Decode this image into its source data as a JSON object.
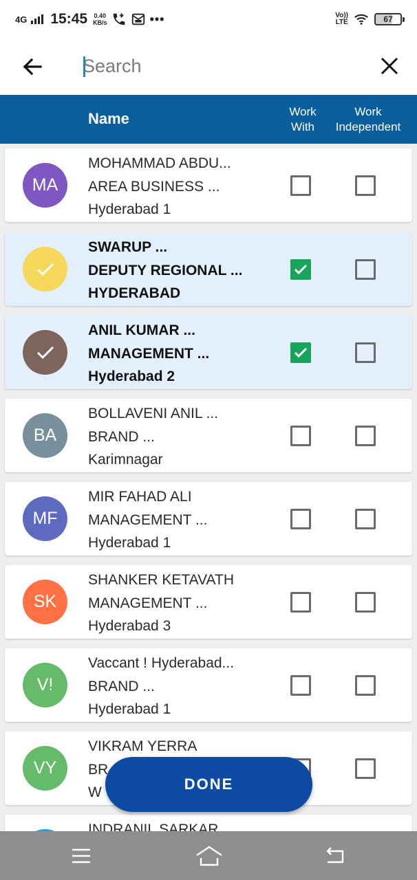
{
  "status_bar": {
    "network": "4G",
    "time": "15:45",
    "speed_value": "0.40",
    "speed_unit": "KB/s",
    "more": "•••",
    "volte_top": "Vo))",
    "volte_bottom": "LTE",
    "battery": "67",
    "icons": [
      "signal-icon",
      "phone-call-icon",
      "message-icon",
      "wifi-icon",
      "battery-icon"
    ]
  },
  "search": {
    "placeholder": "Search",
    "value": "",
    "icons": [
      "back-arrow-icon",
      "close-icon"
    ]
  },
  "table_header": {
    "name": "Name",
    "work_with_line1": "Work",
    "work_with_line2": "With",
    "work_independent_line1": "Work",
    "work_independent_line2": "Independent",
    "background": "#0b5e9c"
  },
  "rows": [
    {
      "initials": "MA",
      "avatar_color": "#7e57c2",
      "selected": false,
      "name": "MOHAMMAD ABDU...",
      "designation": "AREA BUSINESS ...",
      "location": "Hyderabad 1",
      "work_with": false,
      "work_independent": false
    },
    {
      "initials": "",
      "avatar_color": "#f5d85a",
      "selected": true,
      "name": "SWARUP ...",
      "designation": "DEPUTY REGIONAL ...",
      "location": "HYDERABAD",
      "work_with": true,
      "work_independent": false
    },
    {
      "initials": "",
      "avatar_color": "#7d645c",
      "selected": true,
      "name": "ANIL KUMAR ...",
      "designation": "MANAGEMENT ...",
      "location": "Hyderabad 2",
      "work_with": true,
      "work_independent": false
    },
    {
      "initials": "BA",
      "avatar_color": "#78909c",
      "selected": false,
      "name": "BOLLAVENI ANIL ...",
      "designation": "BRAND ...",
      "location": "Karimnagar",
      "work_with": false,
      "work_independent": false
    },
    {
      "initials": "MF",
      "avatar_color": "#5c6bc0",
      "selected": false,
      "name": "MIR FAHAD ALI",
      "designation": "MANAGEMENT ...",
      "location": "Hyderabad 1",
      "work_with": false,
      "work_independent": false
    },
    {
      "initials": "SK",
      "avatar_color": "#ff7043",
      "selected": false,
      "name": "SHANKER KETAVATH",
      "designation": "MANAGEMENT ...",
      "location": "Hyderabad 3",
      "work_with": false,
      "work_independent": false
    },
    {
      "initials": "V!",
      "avatar_color": "#66bb6a",
      "selected": false,
      "name": "Vaccant ! Hyderabad...",
      "designation": "BRAND ...",
      "location": "Hyderabad 1",
      "work_with": false,
      "work_independent": false
    },
    {
      "initials": "VY",
      "avatar_color": "#66bb6a",
      "selected": false,
      "name": "VIKRAM YERRA",
      "designation": "BR",
      "location": "W",
      "work_with": false,
      "work_independent": false
    },
    {
      "initials": "",
      "avatar_color": "#26a0da",
      "selected": false,
      "name": "INDRANIL SARKAR",
      "designation": "",
      "location": "",
      "work_with": false,
      "work_independent": false
    }
  ],
  "done_button": {
    "label": "DONE",
    "color": "#0d4aa3"
  },
  "accent_colors": {
    "checked": "#17a55a",
    "selected_row": "#e3f0fc"
  },
  "nav_bar": {
    "icons": [
      "menu-icon",
      "home-icon",
      "back-icon"
    ]
  }
}
